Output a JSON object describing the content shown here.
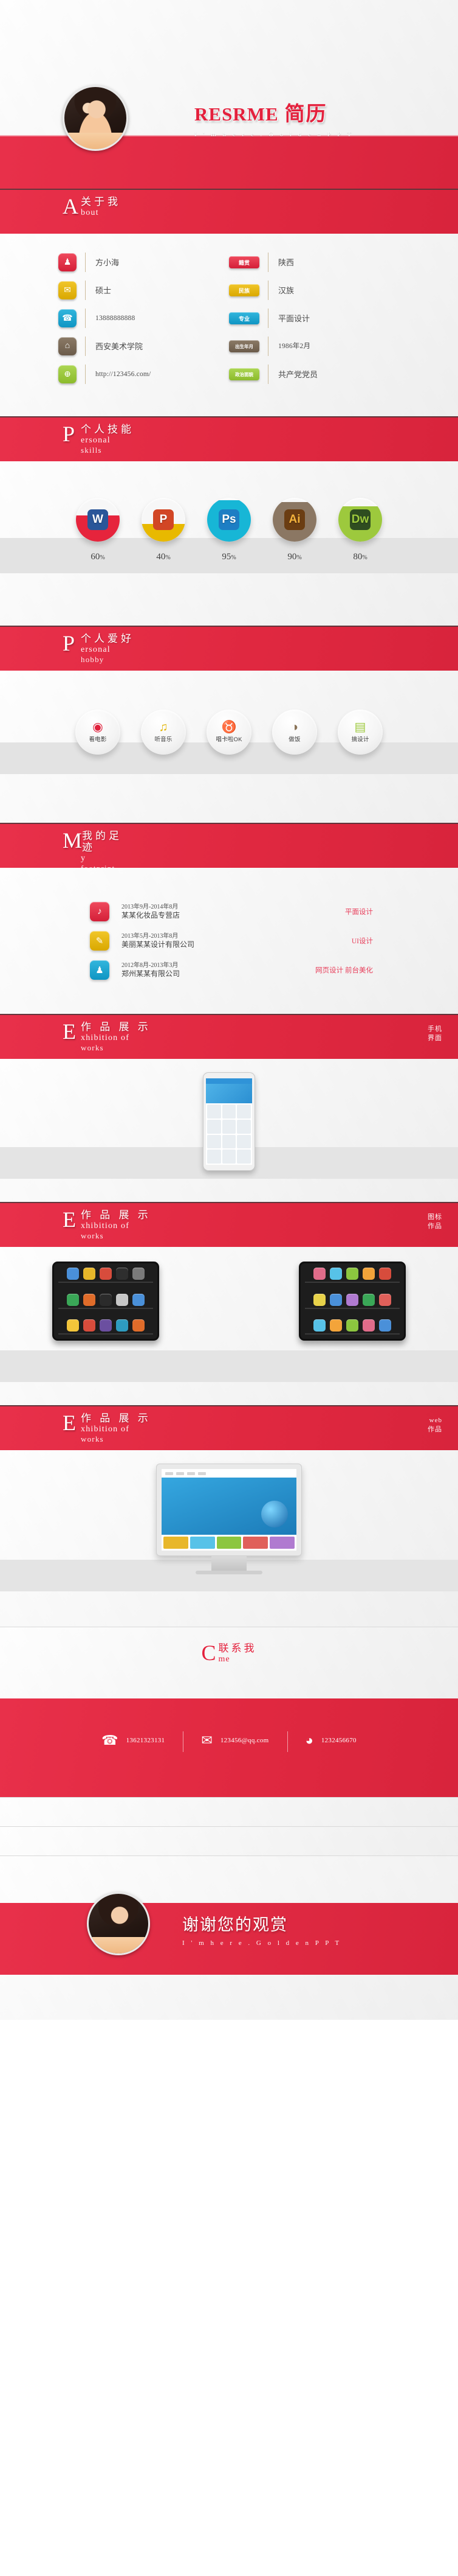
{
  "cover": {
    "title_en": "RESRME",
    "title_cn": "简历",
    "subtitle": "I ' m   h e r e    . G o l d e n P P T",
    "avatar_alt": "portrait-photo"
  },
  "about": {
    "letter": "A",
    "title_cn": "关于我",
    "title_en": "bout",
    "left_rows": [
      {
        "icon": "user-icon",
        "glyph": "♟",
        "color": "#e23a4e",
        "value": "方小海"
      },
      {
        "icon": "diploma-icon",
        "glyph": "✉",
        "color": "#e3b505",
        "value": "硕士"
      },
      {
        "icon": "phone-icon",
        "glyph": "☎",
        "color": "#1ba3cf",
        "value": "13888888888",
        "small": true
      },
      {
        "icon": "school-icon",
        "glyph": "⌂",
        "color": "#7a6a58",
        "value": "西安美术学院"
      },
      {
        "icon": "globe-icon",
        "glyph": "⊕",
        "color": "#9cc93b",
        "value": "http://123456.com/",
        "small": true
      }
    ],
    "right_rows": [
      {
        "tag": "籍贯",
        "color": "#e23a4e",
        "value": "陕西"
      },
      {
        "tag": "民族",
        "color": "#e3b505",
        "value": "汉族"
      },
      {
        "tag": "专业",
        "color": "#1ba3cf",
        "value": "平面设计"
      },
      {
        "tag": "出生年月",
        "color": "#7a6a58",
        "value": "1986年2月",
        "narrow": true
      },
      {
        "tag": "政治面貌",
        "color": "#9cc93b",
        "value": "共产党党员",
        "narrow": true
      }
    ]
  },
  "skills": {
    "letter": "P",
    "title_cn": "个人技能",
    "title_en": "ersonal",
    "title_en2": "skills",
    "items": [
      {
        "name": "word-skill",
        "glyph": "W",
        "chip_color": "#2a5699",
        "fill_color": "#e6243c",
        "pct": "60",
        "pct_suffix": "%",
        "fill_height": 60
      },
      {
        "name": "powerpoint-skill",
        "glyph": "P",
        "chip_color": "#d24625",
        "fill_color": "#e8b900",
        "pct": "40",
        "pct_suffix": "%",
        "fill_height": 40
      },
      {
        "name": "photoshop-skill",
        "glyph": "Ps",
        "chip_color": "#1d7ec4",
        "fill_color": "#17b6d6",
        "pct": "95",
        "pct_suffix": "%",
        "fill_height": 95
      },
      {
        "name": "illustrator-skill",
        "glyph": "Ai",
        "chip_color": "#6b3d12",
        "fill_color": "#8b7763",
        "pct": "90",
        "pct_suffix": "%",
        "fill_height": 90
      },
      {
        "name": "dreamweaver-skill",
        "glyph": "Dw",
        "chip_color": "#2f4d20",
        "fill_color": "#9dc93d",
        "pct": "80",
        "pct_suffix": "%",
        "fill_height": 80
      }
    ]
  },
  "hobbies": {
    "letter": "P",
    "title_cn": "个人爱好",
    "title_en": "ersonal",
    "title_en2": "hobby",
    "items": [
      {
        "name": "movie-hobby",
        "glyph": "◉",
        "color": "#e0213c",
        "label": "看电影"
      },
      {
        "name": "music-hobby",
        "glyph": "♫",
        "color": "#e3b505",
        "label": "听音乐"
      },
      {
        "name": "karaoke-hobby",
        "glyph": "♉",
        "color": "#1ba3cf",
        "label": "唱卡啦OK"
      },
      {
        "name": "cooking-hobby",
        "glyph": "◑",
        "color": "#8a7358",
        "label": "做饭"
      },
      {
        "name": "design-hobby",
        "glyph": "▤",
        "color": "#9dc93d",
        "label": "搞设计"
      }
    ]
  },
  "experience": {
    "letter": "M",
    "title_cn": "我的足迹",
    "title_en": "y",
    "title_en2": "footprint",
    "rows": [
      {
        "icon": "megaphone-icon",
        "glyph": "♪",
        "color": "#e0213c",
        "date": "2013年9月-2014年8月",
        "org": "某某化妆品专营店",
        "tag": "平面设计"
      },
      {
        "icon": "designer-icon",
        "glyph": "✎",
        "color": "#e3b505",
        "date": "2013年5月-2013年8月",
        "org": "美丽某某设计有限公司",
        "tag": "UI设计"
      },
      {
        "icon": "person-icon",
        "glyph": "♟",
        "color": "#1ba3cf",
        "date": "2012年8月-2013年3月",
        "org": "郑州某某有限公司",
        "tag": "网页设计 前台美化"
      }
    ]
  },
  "works": [
    {
      "letter": "E",
      "title_cn": "作 品 展 示",
      "title_en": "xhibition of",
      "title_en2": "works",
      "corner_1": "手机",
      "corner_2": "界面"
    },
    {
      "letter": "E",
      "title_cn": "作 品 展 示",
      "title_en": "xhibition of",
      "title_en2": "works",
      "corner_1": "图标",
      "corner_2": "作品"
    },
    {
      "letter": "E",
      "title_cn": "作 品 展 示",
      "title_en": "xhibition of",
      "title_en2": "works",
      "corner_1": "web",
      "corner_2": "作品"
    }
  ],
  "contact": {
    "letter": "C",
    "title_cn": "联系我",
    "title_en": "me",
    "items": [
      {
        "name": "phone-contact",
        "glyph": "☎",
        "value": "13621323131"
      },
      {
        "name": "email-contact",
        "glyph": "✉",
        "value": "123456@qq.com"
      },
      {
        "name": "wechat-contact",
        "glyph": "◕",
        "value": "1232456670"
      }
    ]
  },
  "thanks": {
    "title_cn": "谢谢您的观赏",
    "subtitle": "I ' m   h e r e    . G o l d e n P P T"
  },
  "colors": {
    "brand_red": "#e0213c",
    "band_red": "#e8304a",
    "light_bg": "#efefef",
    "text_dark": "#3f3f3f"
  }
}
